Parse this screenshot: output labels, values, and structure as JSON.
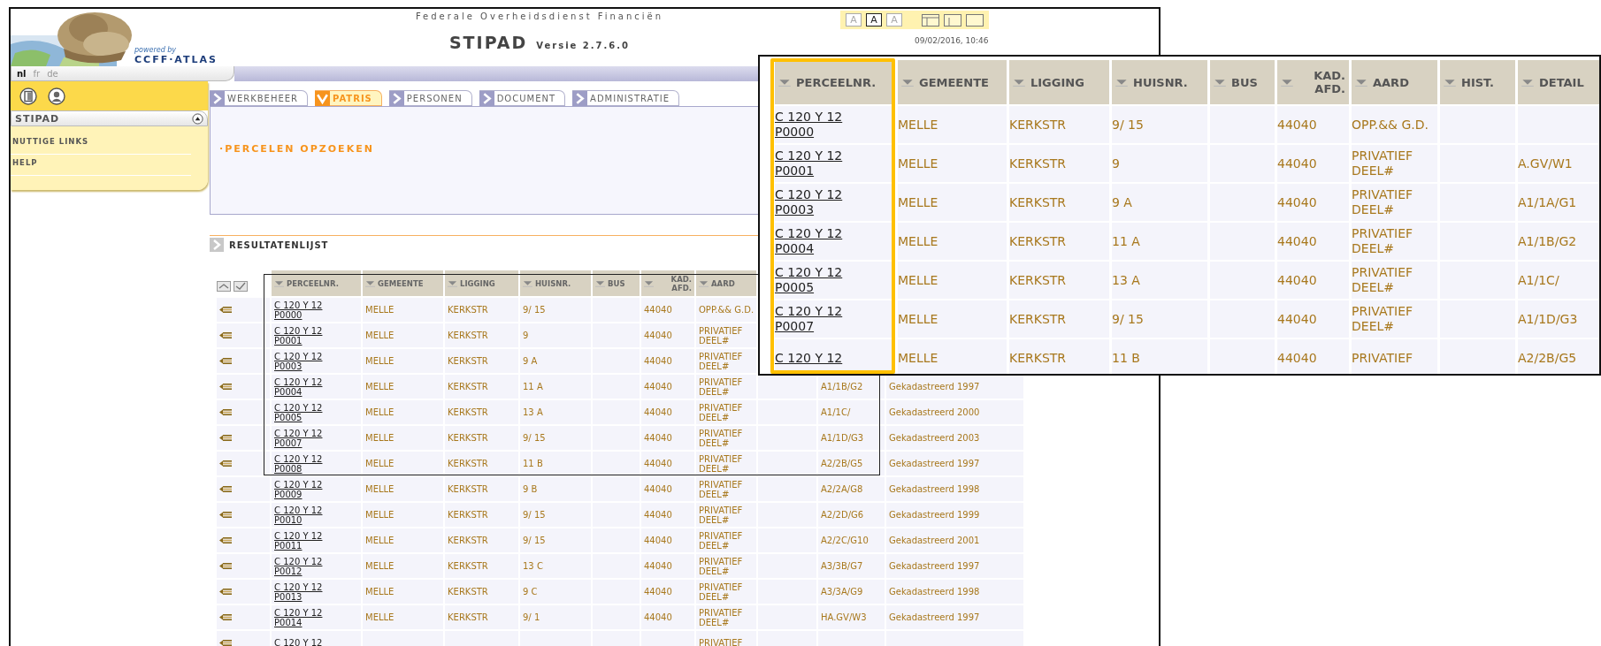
{
  "header": {
    "agency": "Federale Overheidsdienst Financiën",
    "app_name": "STIPAD",
    "version": "Versie 2.7.6.0",
    "powered_by": "powered by",
    "logo_text": "CCFF·ATLAS",
    "date": "09/02/2016, 10:46",
    "font_sizes": [
      {
        "label": "A",
        "selected": false
      },
      {
        "label": "A",
        "selected": true
      },
      {
        "label": "A",
        "selected": false
      }
    ]
  },
  "languages": [
    {
      "label": "nl",
      "selected": true
    },
    {
      "label": "fr",
      "selected": false
    },
    {
      "label": "de",
      "selected": false
    }
  ],
  "sidebar": {
    "title": "STIPAD",
    "items": [
      "NUTTIGE LINKS",
      "HELP"
    ]
  },
  "tabs": [
    {
      "label": "WERKBEHEER",
      "selected": false
    },
    {
      "label": "PATRIS",
      "selected": true
    },
    {
      "label": "PERSONEN",
      "selected": false
    },
    {
      "label": "DOCUMENT",
      "selected": false
    },
    {
      "label": "ADMINISTRATIE",
      "selected": false
    }
  ],
  "panel": {
    "link": "·PERCELEN OPZOEKEN"
  },
  "results": {
    "title": "RESULTATENLIJST",
    "columns": [
      "PERCEELNR.",
      "GEMEENTE",
      "LIGGING",
      "HUISNR.",
      "BUS",
      "KAD. AFD.",
      "AARD"
    ],
    "rows": [
      {
        "parcel": "C 120 Y 12 P0000",
        "municipality": "MELLE",
        "street": "KERKSTR",
        "house_number": "9/ 15",
        "division": "44040",
        "type": "OPP.&& G.D."
      },
      {
        "parcel": "C 120 Y 12 P0001",
        "municipality": "MELLE",
        "street": "KERKSTR",
        "house_number": "9",
        "division": "44040",
        "type": "PRIVATIEF DEEL#"
      },
      {
        "parcel": "C 120 Y 12 P0003",
        "municipality": "MELLE",
        "street": "KERKSTR",
        "house_number": "9 A",
        "division": "44040",
        "type": "PRIVATIEF DEEL#"
      },
      {
        "parcel": "C 120 Y 12 P0004",
        "municipality": "MELLE",
        "street": "KERKSTR",
        "house_number": "11 A",
        "division": "44040",
        "type": "PRIVATIEF DEEL#",
        "detail": "A1/1B/G2",
        "status": "Gekadastreerd 1997"
      },
      {
        "parcel": "C 120 Y 12 P0005",
        "municipality": "MELLE",
        "street": "KERKSTR",
        "house_number": "13 A",
        "division": "44040",
        "type": "PRIVATIEF DEEL#",
        "detail": "A1/1C/",
        "status": "Gekadastreerd 2000"
      },
      {
        "parcel": "C 120 Y 12 P0007",
        "municipality": "MELLE",
        "street": "KERKSTR",
        "house_number": "9/ 15",
        "division": "44040",
        "type": "PRIVATIEF DEEL#",
        "detail": "A1/1D/G3",
        "status": "Gekadastreerd 2003"
      },
      {
        "parcel": "C 120 Y 12 P0008",
        "municipality": "MELLE",
        "street": "KERKSTR",
        "house_number": "11 B",
        "division": "44040",
        "type": "PRIVATIEF DEEL#",
        "detail": "A2/2B/G5",
        "status": "Gekadastreerd 1997"
      },
      {
        "parcel": "C 120 Y 12 P0009",
        "municipality": "MELLE",
        "street": "KERKSTR",
        "house_number": "9 B",
        "division": "44040",
        "type": "PRIVATIEF DEEL#",
        "detail": "A2/2A/G8",
        "status": "Gekadastreerd 1998"
      },
      {
        "parcel": "C 120 Y 12 P0010",
        "municipality": "MELLE",
        "street": "KERKSTR",
        "house_number": "9/ 15",
        "division": "44040",
        "type": "PRIVATIEF DEEL#",
        "detail": "A2/2D/G6",
        "status": "Gekadastreerd 1999"
      },
      {
        "parcel": "C 120 Y 12 P0011",
        "municipality": "MELLE",
        "street": "KERKSTR",
        "house_number": "9/ 15",
        "division": "44040",
        "type": "PRIVATIEF DEEL#",
        "detail": "A2/2C/G10",
        "status": "Gekadastreerd 2001"
      },
      {
        "parcel": "C 120 Y 12 P0012",
        "municipality": "MELLE",
        "street": "KERKSTR",
        "house_number": "13 C",
        "division": "44040",
        "type": "PRIVATIEF DEEL#",
        "detail": "A3/3B/G7",
        "status": "Gekadastreerd 1997"
      },
      {
        "parcel": "C 120 Y 12 P0013",
        "municipality": "MELLE",
        "street": "KERKSTR",
        "house_number": "9 C",
        "division": "44040",
        "type": "PRIVATIEF DEEL#",
        "detail": "A3/3A/G9",
        "status": "Gekadastreerd 1998"
      },
      {
        "parcel": "C 120 Y 12 P0014",
        "municipality": "MELLE",
        "street": "KERKSTR",
        "house_number": "9/ 1",
        "division": "44040",
        "type": "PRIVATIEF DEEL#",
        "detail": "HA.GV/W3",
        "status": "Gekadastreerd 1997"
      },
      {
        "parcel": "C 120 Y 12",
        "type": "PRIVATIEF"
      }
    ]
  },
  "zoom_inset": {
    "columns": [
      "PERCEELNR.",
      "GEMEENTE",
      "LIGGING",
      "HUISNR.",
      "BUS",
      "KAD. AFD.",
      "AARD",
      "HIST.",
      "DETAIL"
    ],
    "rows": [
      {
        "parcel": "C 120 Y 12 P0000",
        "municipality": "MELLE",
        "street": "KERKSTR",
        "house_number": "9/ 15",
        "division": "44040",
        "type": "OPP.&& G.D."
      },
      {
        "parcel": "C 120 Y 12 P0001",
        "municipality": "MELLE",
        "street": "KERKSTR",
        "house_number": "9",
        "division": "44040",
        "type": "PRIVATIEF DEEL#",
        "detail": "A.GV/W1"
      },
      {
        "parcel": "C 120 Y 12 P0003",
        "municipality": "MELLE",
        "street": "KERKSTR",
        "house_number": "9 A",
        "division": "44040",
        "type": "PRIVATIEF DEEL#",
        "detail": "A1/1A/G1"
      },
      {
        "parcel": "C 120 Y 12 P0004",
        "municipality": "MELLE",
        "street": "KERKSTR",
        "house_number": "11 A",
        "division": "44040",
        "type": "PRIVATIEF DEEL#",
        "detail": "A1/1B/G2"
      },
      {
        "parcel": "C 120 Y 12 P0005",
        "municipality": "MELLE",
        "street": "KERKSTR",
        "house_number": "13 A",
        "division": "44040",
        "type": "PRIVATIEF DEEL#",
        "detail": "A1/1C/"
      },
      {
        "parcel": "C 120 Y 12 P0007",
        "municipality": "MELLE",
        "street": "KERKSTR",
        "house_number": "9/ 15",
        "division": "44040",
        "type": "PRIVATIEF DEEL#",
        "detail": "A1/1D/G3"
      },
      {
        "parcel": "C 120 Y 12",
        "municipality": "MELLE",
        "street": "KERKSTR",
        "house_number": "11 B",
        "division": "44040",
        "type": "PRIVATIEF",
        "detail": "A2/2B/G5"
      }
    ]
  }
}
